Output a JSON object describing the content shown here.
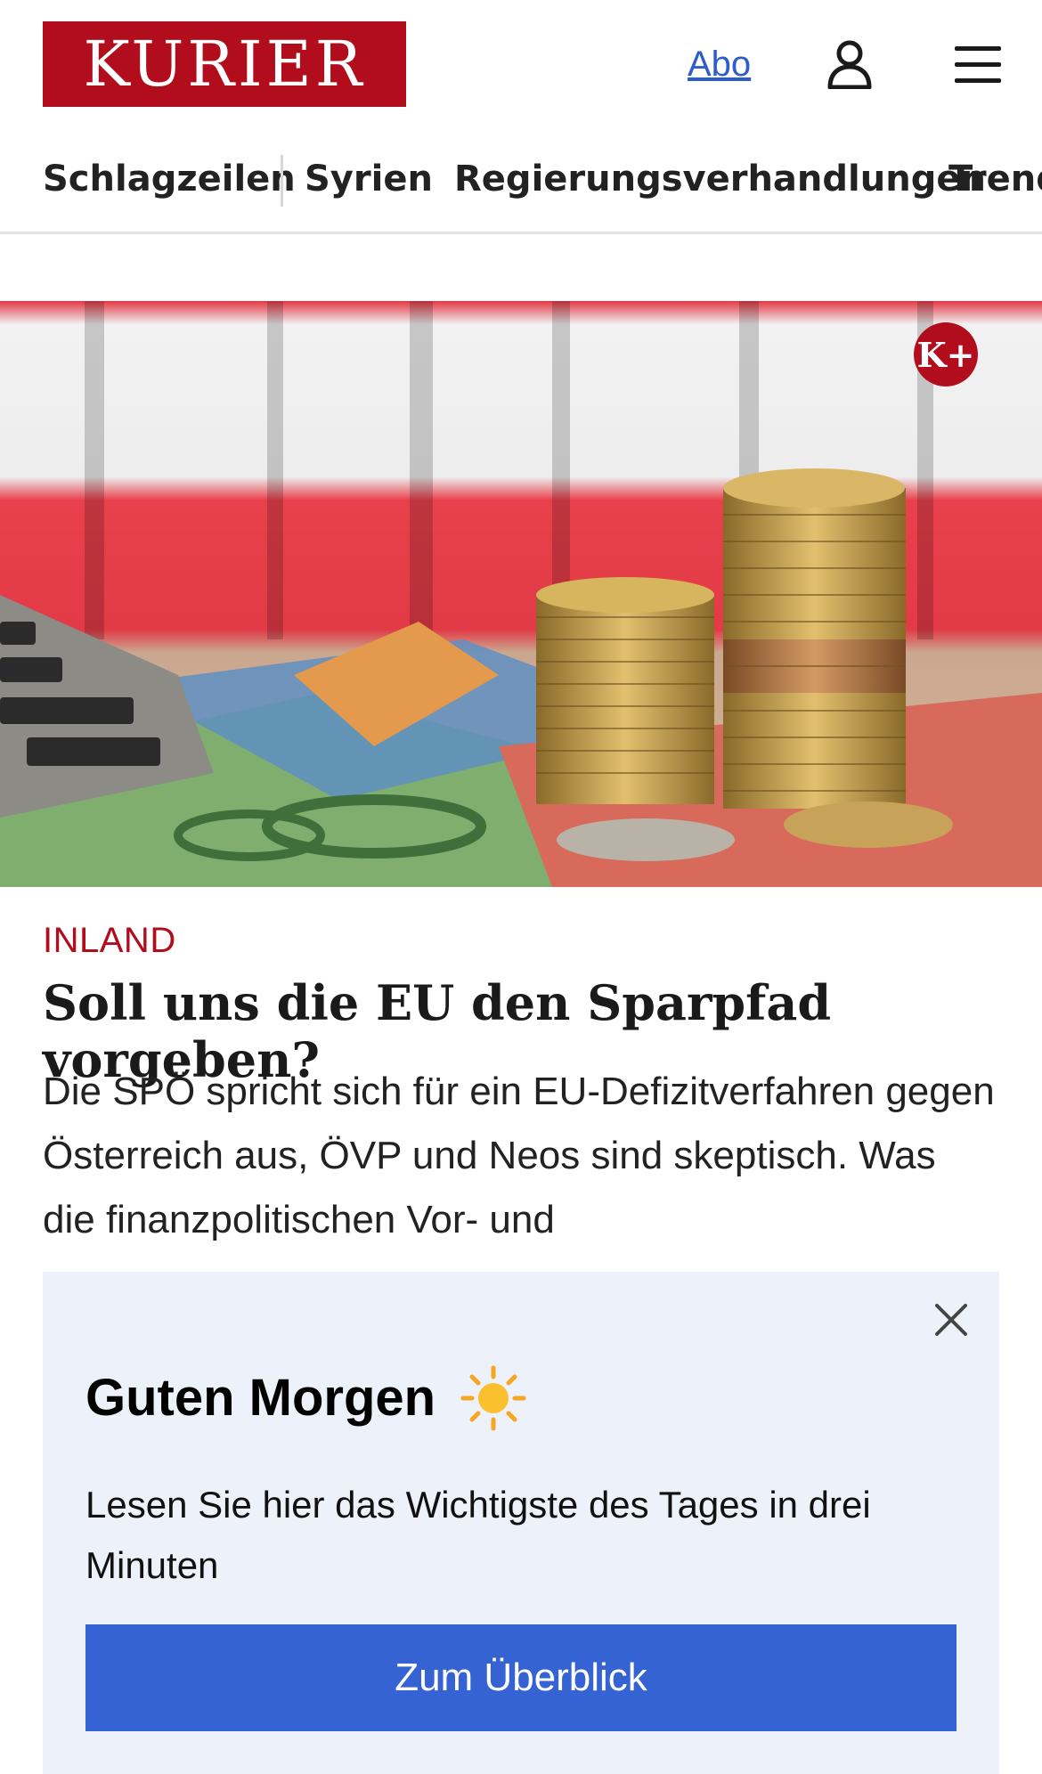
{
  "header": {
    "logo_text": "KURIER",
    "abo_label": "Abo",
    "user_icon": "user-icon",
    "menu_icon": "hamburger-menu-icon",
    "brand_color": "#b10d1d"
  },
  "nav": {
    "items": [
      "Schlagzeilen",
      "Syrien",
      "Regierungsverhandlungen",
      "Trend"
    ]
  },
  "article": {
    "badge": "K+",
    "category": "INLAND",
    "title": "Soll uns die EU den Sparpfad vorgeben?",
    "teaser": "Die SPÖ spricht sich für ein EU-Defizitverfahren gegen Österreich aus, ÖVP und Neos sind skeptisch. Was die finanzpolitischen Vor- und"
  },
  "popup": {
    "title": "Guten Morgen",
    "title_icon": "sun-icon",
    "text": "Lesen Sie hier das Wichtigste des Tages in drei Minuten",
    "button_label": "Zum Überblick",
    "close_icon": "close-icon",
    "button_color": "#3563d3"
  }
}
